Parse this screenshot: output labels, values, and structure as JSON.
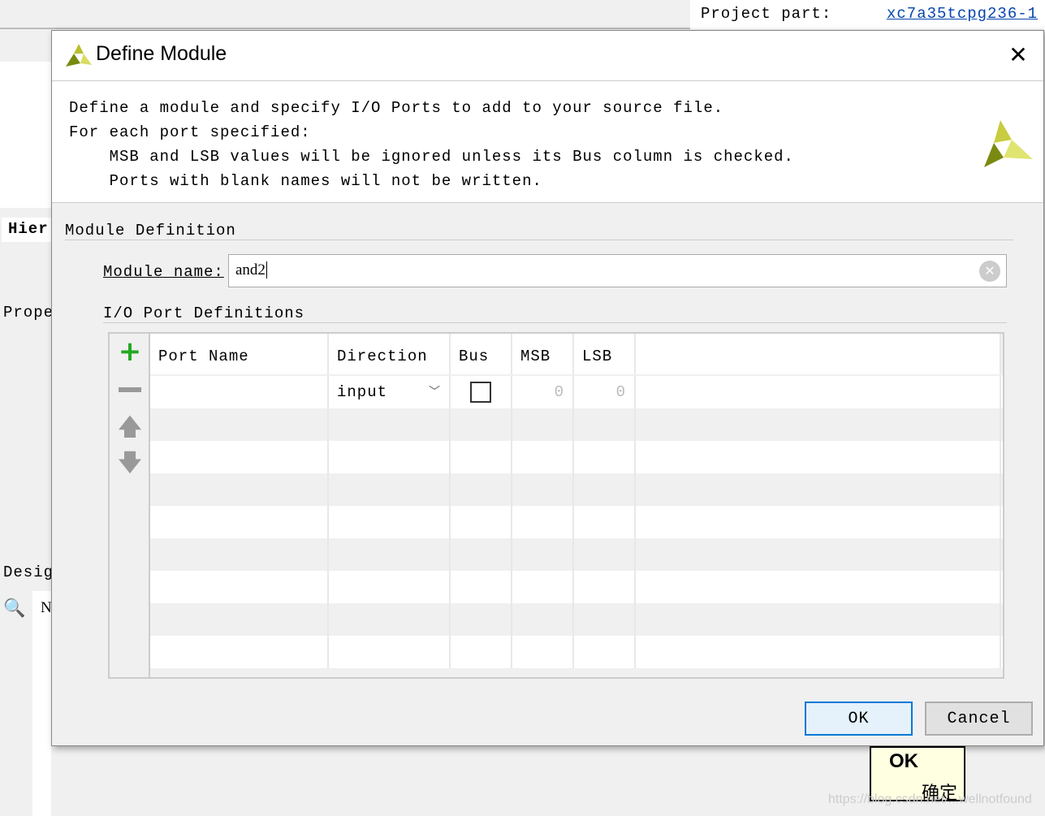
{
  "background": {
    "project_part_label": "Project part:",
    "project_part_value": "xc7a35tcpg236-1",
    "left_panel_tabs": [
      "Hier",
      "Prope",
      "Desig"
    ],
    "left_tree_letter": "N"
  },
  "dialog": {
    "title": "Define Module",
    "close_icon": "close-icon",
    "description": [
      "Define a module and specify I/O Ports to add to your source file.",
      "For each port specified:",
      "    MSB and LSB values will be ignored unless its Bus column is checked.",
      "    Ports with blank names will not be written."
    ],
    "module_definition_label": "Module Definition",
    "module_name_label": "Module name:",
    "module_name_value": "and2",
    "io_port_label": "I/O Port Definitions",
    "table": {
      "columns": [
        "Port Name",
        "Direction",
        "Bus",
        "MSB",
        "LSB"
      ],
      "rows": [
        {
          "port_name": "",
          "direction": "input",
          "bus": false,
          "msb": "0",
          "lsb": "0"
        }
      ]
    },
    "ok_label": "OK",
    "cancel_label": "Cancel"
  },
  "tooltip": {
    "title": "OK",
    "subtitle": "确定"
  },
  "watermark": "https://blog.csdn.net/...wellnotfound",
  "colors": {
    "accent": "#0078d7",
    "ok_bg": "#e5f1fb",
    "add_green": "#22a822",
    "tooltip_bg": "#ffffe1",
    "link": "#0645ad"
  }
}
